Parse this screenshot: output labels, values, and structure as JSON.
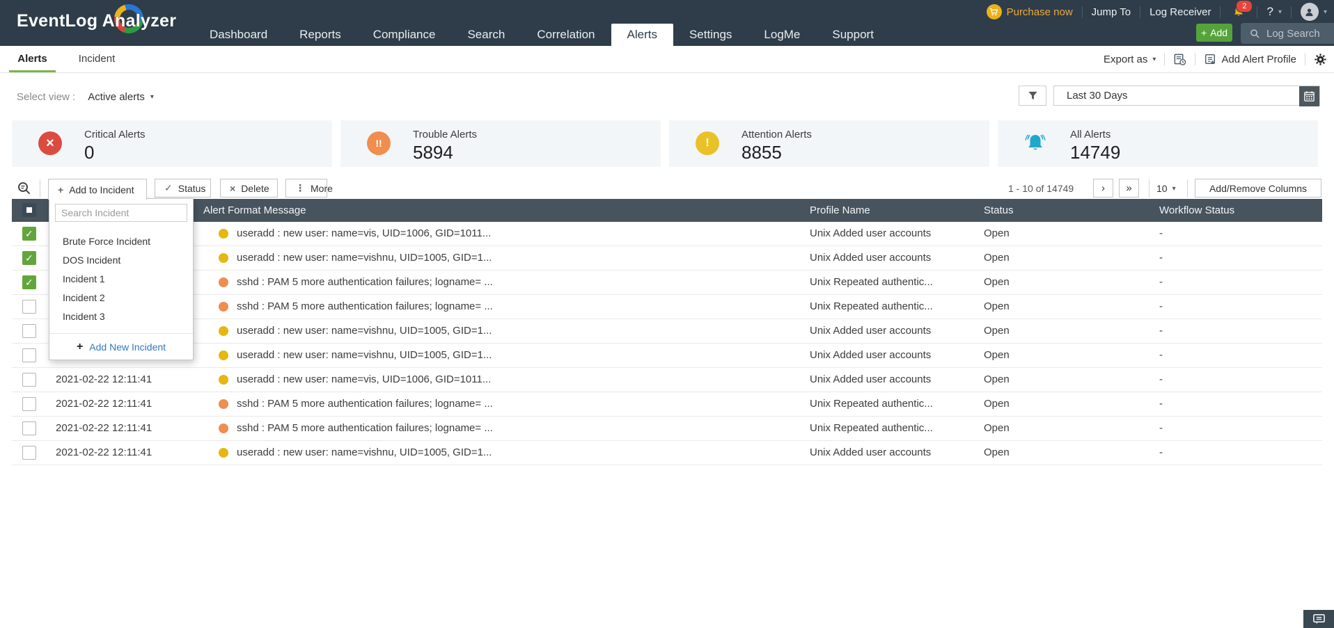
{
  "ui": {
    "caret_down": "▾"
  },
  "topbar": {
    "product_name": "EventLog Analyzer",
    "nav": [
      {
        "label": "Dashboard"
      },
      {
        "label": "Reports"
      },
      {
        "label": "Compliance"
      },
      {
        "label": "Search"
      },
      {
        "label": "Correlation"
      },
      {
        "label": "Alerts",
        "active": true
      },
      {
        "label": "Settings"
      },
      {
        "label": "LogMe"
      },
      {
        "label": "Support"
      }
    ],
    "purchase_now": "Purchase now",
    "jump_to": "Jump To",
    "log_receiver": "Log Receiver",
    "notification_count": "2",
    "help_label": "?",
    "add_button": {
      "icon": "+",
      "label": "Add"
    },
    "log_search_label": "Log Search"
  },
  "tabbar": {
    "tabs": [
      {
        "label": "Alerts",
        "active": true
      },
      {
        "label": "Incident"
      }
    ],
    "export_label": "Export as",
    "add_alert_profile_label": "Add Alert Profile"
  },
  "filters": {
    "select_view_label": "Select view :",
    "selected_view": "Active alerts",
    "date_range": "Last 30 Days"
  },
  "summary_cards": [
    {
      "label": "Critical Alerts",
      "value": "0",
      "icon": "x-circle-icon",
      "glyph": "×",
      "color": "#dc4b40"
    },
    {
      "label": "Trouble Alerts",
      "value": "5894",
      "icon": "double-exclamation-circle-icon",
      "glyph": "!!",
      "color": "#ef8e4e"
    },
    {
      "label": "Attention Alerts",
      "value": "8855",
      "icon": "exclamation-circle-icon",
      "glyph": "!",
      "color": "#e9c227"
    },
    {
      "label": "All Alerts",
      "value": "14749",
      "icon": "bell-icon",
      "color": "#22a7cc"
    }
  ],
  "toolbar": {
    "add_to_incident": {
      "icon": "+",
      "label": "Add to Incident"
    },
    "status": {
      "icon": "✓",
      "label": "Status"
    },
    "delete": {
      "icon": "×",
      "label": "Delete"
    },
    "more": {
      "icon": "⋮",
      "label": "More"
    },
    "pagination": {
      "range": "1 - 10 of 14749",
      "next": "›",
      "last": "»",
      "page_size": "10"
    },
    "add_remove_columns": "Add/Remove Columns"
  },
  "incident_dropdown": {
    "search_placeholder": "Search Incident",
    "items": [
      "Brute Force Incident",
      "DOS Incident",
      "Incident 1",
      "Incident 2",
      "Incident 3"
    ],
    "add_new": {
      "icon": "+",
      "label": "Add New Incident"
    }
  },
  "table": {
    "header_checked": true,
    "headers": {
      "message": "Alert Format Message",
      "profile": "Profile Name",
      "status": "Status",
      "workflow": "Workflow Status"
    },
    "rows": [
      {
        "checked": true,
        "time": "",
        "dot_color": "#e5b712",
        "message": "useradd : new user: name=vis, UID=1006, GID=1011...",
        "profile": "Unix Added user accounts",
        "status": "Open",
        "workflow": "-"
      },
      {
        "checked": true,
        "time": "",
        "dot_color": "#e5b712",
        "message": "useradd : new user: name=vishnu, UID=1005, GID=1...",
        "profile": "Unix Added user accounts",
        "status": "Open",
        "workflow": "-"
      },
      {
        "checked": true,
        "time": "",
        "dot_color": "#ef8e4e",
        "message": "sshd : PAM 5 more authentication failures; logname= ...",
        "profile": "Unix Repeated authentic...",
        "status": "Open",
        "workflow": "-"
      },
      {
        "checked": false,
        "time": "",
        "dot_color": "#ef8e4e",
        "message": "sshd : PAM 5 more authentication failures; logname= ...",
        "profile": "Unix Repeated authentic...",
        "status": "Open",
        "workflow": "-"
      },
      {
        "checked": false,
        "time": "",
        "dot_color": "#e5b712",
        "message": "useradd : new user: name=vishnu, UID=1005, GID=1...",
        "profile": "Unix Added user accounts",
        "status": "Open",
        "workflow": "-"
      },
      {
        "checked": false,
        "time": "",
        "dot_color": "#e5b712",
        "message": "useradd : new user: name=vishnu, UID=1005, GID=1...",
        "profile": "Unix Added user accounts",
        "status": "Open",
        "workflow": "-"
      },
      {
        "checked": false,
        "time": "2021-02-22 12:11:41",
        "dot_color": "#e5b712",
        "message": "useradd : new user: name=vis, UID=1006, GID=1011...",
        "profile": "Unix Added user accounts",
        "status": "Open",
        "workflow": "-"
      },
      {
        "checked": false,
        "time": "2021-02-22 12:11:41",
        "dot_color": "#ef8e4e",
        "message": "sshd : PAM 5 more authentication failures; logname= ...",
        "profile": "Unix Repeated authentic...",
        "status": "Open",
        "workflow": "-"
      },
      {
        "checked": false,
        "time": "2021-02-22 12:11:41",
        "dot_color": "#ef8e4e",
        "message": "sshd : PAM 5 more authentication failures; logname= ...",
        "profile": "Unix Repeated authentic...",
        "status": "Open",
        "workflow": "-"
      },
      {
        "checked": false,
        "time": "2021-02-22 12:11:41",
        "dot_color": "#e5b712",
        "message": "useradd : new user: name=vishnu, UID=1005, GID=1...",
        "profile": "Unix Added user accounts",
        "status": "Open",
        "workflow": "-"
      }
    ]
  }
}
